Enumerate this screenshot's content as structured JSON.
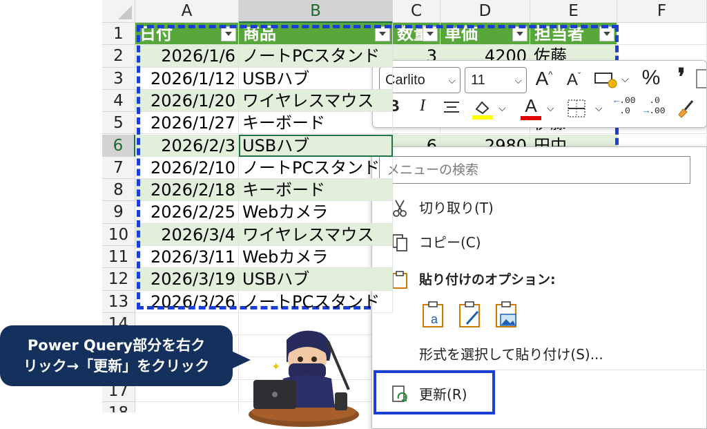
{
  "columns": [
    "A",
    "B",
    "C",
    "D",
    "E",
    "F"
  ],
  "rows": [
    "1",
    "2",
    "3",
    "4",
    "5",
    "6",
    "7",
    "8",
    "9",
    "10",
    "11",
    "12",
    "13",
    "14",
    "15",
    "16",
    "17",
    "18"
  ],
  "headers": [
    "日付",
    "商品",
    "数量",
    "単価",
    "担当者"
  ],
  "data": [
    {
      "date": "2026/1/6",
      "item": "ノートPCスタンド",
      "qty": "3",
      "price": "4200",
      "owner": "佐藤"
    },
    {
      "date": "2026/1/12",
      "item": "USBハブ",
      "qty": "",
      "price": "",
      "owner": ""
    },
    {
      "date": "2026/1/20",
      "item": "ワイヤレスマウス",
      "qty": "",
      "price": "",
      "owner": ""
    },
    {
      "date": "2026/1/27",
      "item": "キーボード",
      "qty": "",
      "price": "",
      "owner": "伊藤"
    },
    {
      "date": "2026/2/3",
      "item": "USBハブ",
      "qty": "6",
      "price": "2980",
      "owner": "田中"
    },
    {
      "date": "2026/2/10",
      "item": "ノートPCスタンド",
      "qty": "",
      "price": "",
      "owner": ""
    },
    {
      "date": "2026/2/18",
      "item": "キーボード",
      "qty": "",
      "price": "",
      "owner": ""
    },
    {
      "date": "2026/2/25",
      "item": "Webカメラ",
      "qty": "",
      "price": "",
      "owner": ""
    },
    {
      "date": "2026/3/4",
      "item": "ワイヤレスマウス",
      "qty": "",
      "price": "",
      "owner": ""
    },
    {
      "date": "2026/3/11",
      "item": "Webカメラ",
      "qty": "",
      "price": "",
      "owner": ""
    },
    {
      "date": "2026/3/19",
      "item": "USBハブ",
      "qty": "",
      "price": "",
      "owner": ""
    },
    {
      "date": "2026/3/26",
      "item": "ノートPCスタンド",
      "qty": "",
      "price": "",
      "owner": ""
    }
  ],
  "toolbar": {
    "font_name": "Carlito",
    "font_size": "11",
    "grow": "A",
    "shrink": "A",
    "percent": "%",
    "comma": "❜",
    "bold": "B",
    "italic": "I",
    "font_color_letter": "A",
    "dec_inc": ".00",
    "dec_dec": ".00",
    "accent_red": "#e00000",
    "accent_yellow": "#ffff00"
  },
  "menu": {
    "search_placeholder": "メニューの検索",
    "cut": "切り取り(T)",
    "copy": "コピー(C)",
    "paste_options": "貼り付けのオプション:",
    "paste_special": "形式を選択して貼り付け(S)...",
    "refresh": "更新(R)"
  },
  "callout": {
    "line1": "Power Query部分を右ク",
    "line2": "リック→「更新」をクリック"
  },
  "colors": {
    "table_header": "#57a73b",
    "band": "#e2efda",
    "highlight": "#1a3fd6",
    "callout": "#14305c"
  }
}
